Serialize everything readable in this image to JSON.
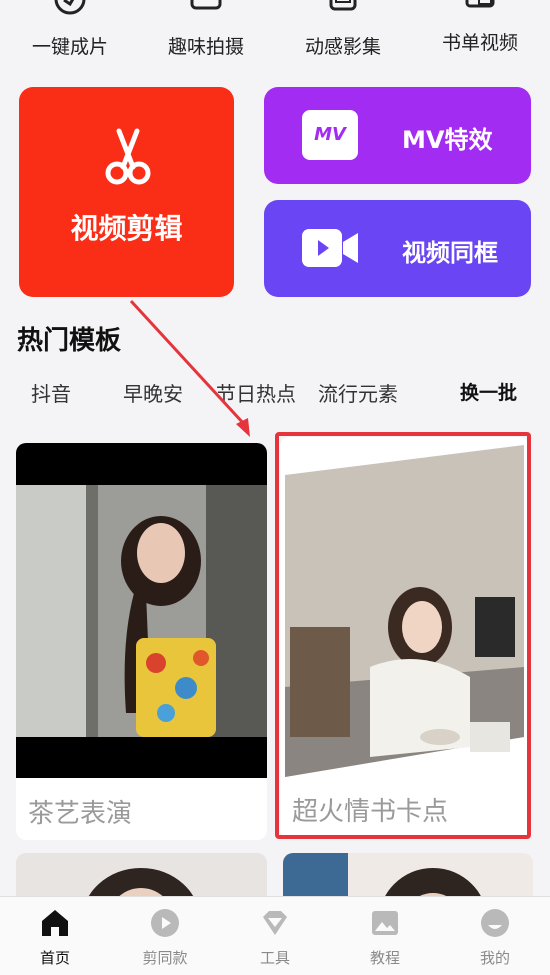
{
  "quick_actions": [
    {
      "label": "一键成片",
      "icon": "one-click-icon"
    },
    {
      "label": "趣味拍摄",
      "icon": "camera-icon"
    },
    {
      "label": "动感影集",
      "icon": "album-icon"
    },
    {
      "label": "书单视频",
      "icon": "booklist-icon"
    }
  ],
  "tiles": {
    "video_edit": {
      "label": "视频剪辑",
      "icon": "scissors-icon",
      "color": "#fa2d17"
    },
    "mv": {
      "label": "MV特效",
      "icon": "mv-icon",
      "badge": "MV",
      "color": "#a22cf2"
    },
    "dual": {
      "label": "视频同框",
      "icon": "video-camera-icon",
      "color": "#6a45f3"
    }
  },
  "section": {
    "title": "热门模板",
    "refresh_label": "换一批"
  },
  "tabs": [
    "抖音",
    "早晚安",
    "节日热点",
    "流行元素"
  ],
  "templates": [
    {
      "title": "茶艺表演"
    },
    {
      "title": "超火情书卡点"
    }
  ],
  "bottom_nav": [
    {
      "label": "首页",
      "icon": "home-icon",
      "active": true
    },
    {
      "label": "剪同款",
      "icon": "play-icon",
      "active": false
    },
    {
      "label": "工具",
      "icon": "diamond-icon",
      "active": false
    },
    {
      "label": "教程",
      "icon": "image-icon",
      "active": false
    },
    {
      "label": "我的",
      "icon": "profile-icon",
      "active": false
    }
  ],
  "colors": {
    "highlight": "#e5343c",
    "arrow": "#e5343c"
  }
}
